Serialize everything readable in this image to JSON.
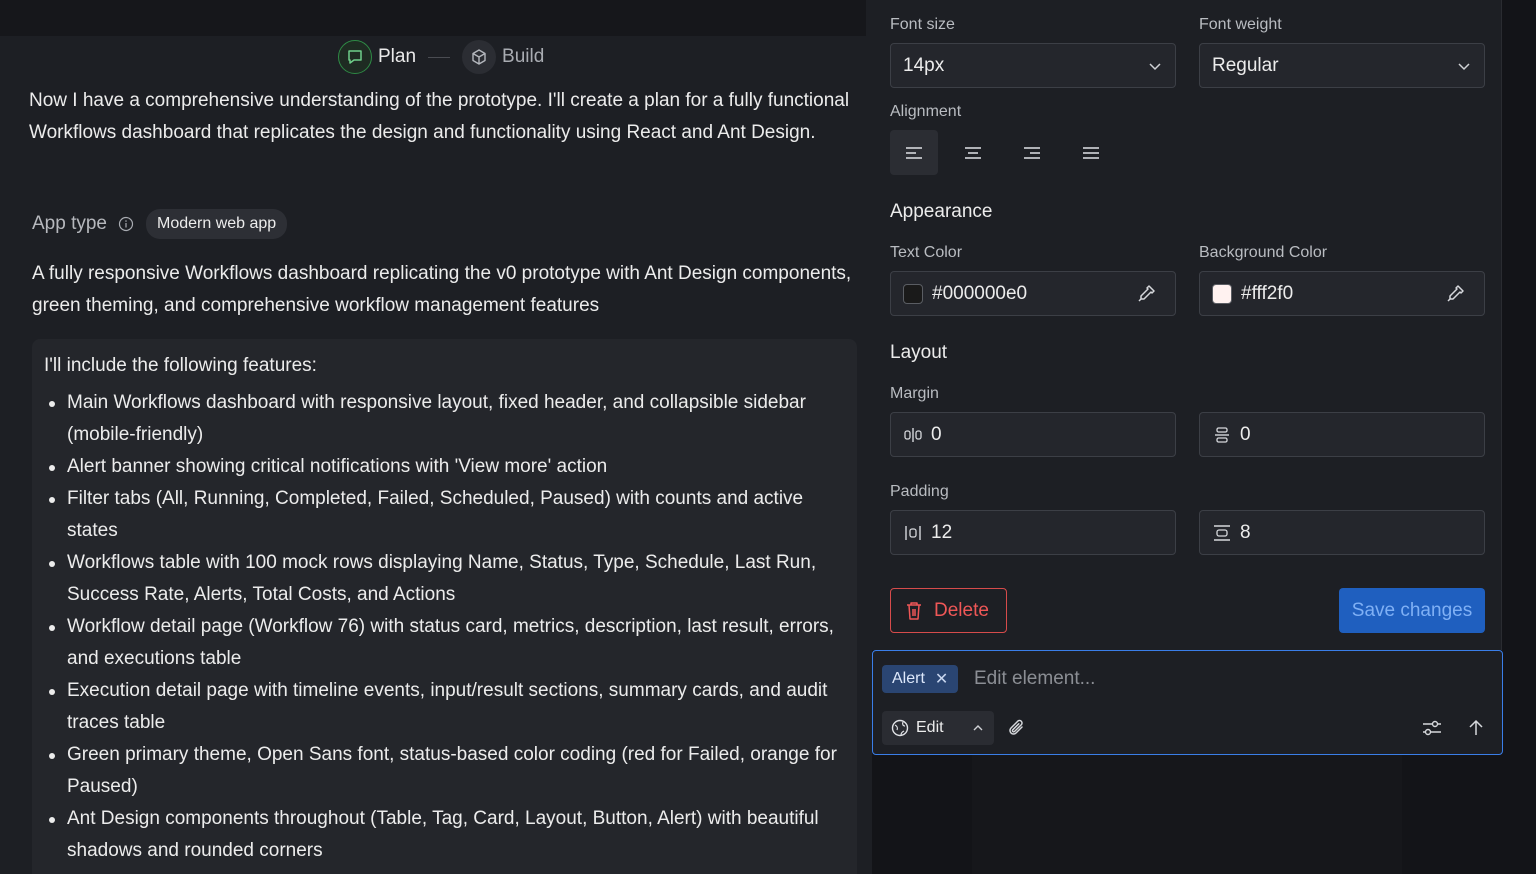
{
  "stepper": {
    "plan_label": "Plan",
    "build_label": "Build"
  },
  "intro": "Now I have a comprehensive understanding of the prototype. I'll create a plan for a fully functional Workflows dashboard that replicates the design and functionality using React and Ant Design.",
  "app_type": {
    "label": "App type",
    "value": "Modern web app"
  },
  "description": "A fully responsive Workflows dashboard replicating the v0 prototype with Ant Design components, green theming, and comprehensive workflow management features",
  "features": {
    "title": "I'll include the following features:",
    "items": [
      "Main Workflows dashboard with responsive layout, fixed header, and collapsible sidebar (mobile-friendly)",
      "Alert banner showing critical notifications with 'View more' action",
      "Filter tabs (All, Running, Completed, Failed, Scheduled, Paused) with counts and active states",
      "Workflows table with 100 mock rows displaying Name, Status, Type, Schedule, Last Run, Success Rate, Alerts, Total Costs, and Actions",
      "Workflow detail page (Workflow 76) with status card, metrics, description, last result, errors, and executions table",
      "Execution detail page with timeline events, input/result sections, summary cards, and audit traces table",
      "Green primary theme, Open Sans font, status-based color coding (red for Failed, orange for Paused)",
      "Ant Design components throughout (Table, Tag, Card, Layout, Button, Alert) with beautiful shadows and rounded corners"
    ]
  },
  "panel": {
    "font_size_label": "Font size",
    "font_size_value": "14px",
    "font_weight_label": "Font weight",
    "font_weight_value": "Regular",
    "alignment_label": "Alignment",
    "appearance_title": "Appearance",
    "text_color_label": "Text Color",
    "text_color_value": "#000000e0",
    "bg_color_label": "Background Color",
    "bg_color_value": "#fff2f0",
    "layout_title": "Layout",
    "margin_label": "Margin",
    "margin_h": "0",
    "margin_v": "0",
    "padding_label": "Padding",
    "padding_h": "12",
    "padding_v": "8",
    "delete_label": "Delete",
    "save_label": "Save changes"
  },
  "editor": {
    "tag_label": "Alert",
    "placeholder": "Edit element...",
    "mode_label": "Edit"
  },
  "colors": {
    "text_swatch": "#000000e0",
    "bg_swatch": "#fff2f0",
    "accent": "#1f5fbf",
    "danger": "#d64b4b",
    "plan_accent": "#2e8a45"
  },
  "icons": [
    "plan-chat-icon",
    "build-cube-icon",
    "info-icon",
    "chevron-down-icon",
    "align-left-icon",
    "align-center-icon",
    "align-right-icon",
    "align-justify-icon",
    "eyedropper-icon",
    "margin-horizontal-icon",
    "margin-vertical-icon",
    "padding-horizontal-icon",
    "padding-vertical-icon",
    "trash-icon",
    "close-icon",
    "globe-icon",
    "caret-up-icon",
    "paperclip-icon",
    "sliders-icon",
    "send-arrow-icon"
  ]
}
